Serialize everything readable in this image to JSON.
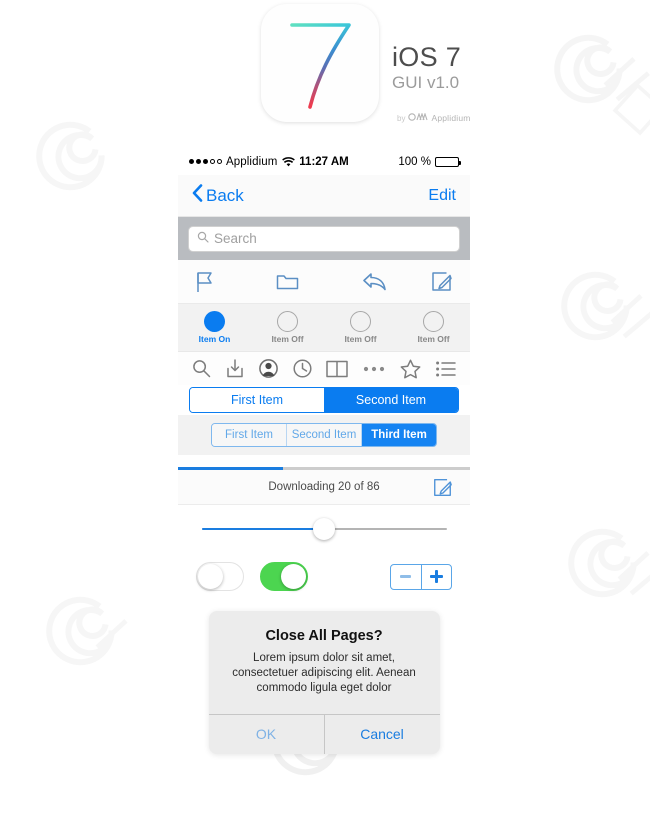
{
  "header": {
    "app_icon_name": "ios7-app-icon",
    "title": "iOS 7",
    "subtitle": "GUI v1.0",
    "byline_prefix": "by",
    "byline_brand": "Applidium"
  },
  "status_bar": {
    "carrier": "Applidium",
    "wifi_icon": "wifi-icon",
    "time": "11:27 AM",
    "battery_percent": "100 %",
    "battery_level": 100,
    "signal_filled": 3,
    "signal_hollow": 2
  },
  "nav_bar": {
    "back_label": "Back",
    "back_icon": "chevron-left-icon",
    "edit_label": "Edit"
  },
  "search": {
    "placeholder": "Search",
    "value": "",
    "icon": "search-icon"
  },
  "mail_toolbar": {
    "items": [
      {
        "name": "flag-icon",
        "label": "Flag"
      },
      {
        "name": "folder-icon",
        "label": "Folder"
      },
      {
        "name": "reply-icon",
        "label": "Reply"
      },
      {
        "name": "compose-icon",
        "label": "Compose"
      }
    ]
  },
  "radio_row": {
    "items": [
      {
        "label": "Item On",
        "state": "on"
      },
      {
        "label": "Item Off",
        "state": "off"
      },
      {
        "label": "Item Off",
        "state": "off"
      },
      {
        "label": "Item Off",
        "state": "off"
      }
    ]
  },
  "gray_toolbar": {
    "items": [
      {
        "name": "search-icon"
      },
      {
        "name": "download-icon"
      },
      {
        "name": "contact-icon"
      },
      {
        "name": "clock-icon"
      },
      {
        "name": "book-icon"
      },
      {
        "name": "ellipsis-icon"
      },
      {
        "name": "star-icon"
      },
      {
        "name": "list-icon"
      }
    ]
  },
  "segmented_two": {
    "segments": [
      {
        "label": "First Item",
        "selected": false
      },
      {
        "label": "Second Item",
        "selected": true
      }
    ]
  },
  "segmented_three": {
    "segments": [
      {
        "label": "First Item",
        "selected": false
      },
      {
        "label": "Second Item",
        "selected": false
      },
      {
        "label": "Third Item",
        "selected": true
      }
    ]
  },
  "progress": {
    "percent": 36,
    "status_text": "Downloading 20 of 86",
    "current": 20,
    "total": 86,
    "action_icon": "compose-icon"
  },
  "slider": {
    "value_percent": 50
  },
  "toggles": [
    {
      "name": "toggle-off",
      "state": "off"
    },
    {
      "name": "toggle-on",
      "state": "on"
    }
  ],
  "stepper": {
    "minus_label": "−",
    "plus_label": "+"
  },
  "alert": {
    "title": "Close All Pages?",
    "message": "Lorem ipsum dolor sit amet, consectetuer adipiscing elit. Aenean commodo ligula eget dolor",
    "ok_label": "OK",
    "cancel_label": "Cancel"
  },
  "colors": {
    "accent_blue": "#0a7cf0",
    "segment_blue": "#1684f2",
    "toggle_green": "#4cd550",
    "search_bar_gray": "#b9bcc0",
    "alert_gray": "#ececec",
    "text_dark": "#4d4d4d"
  }
}
